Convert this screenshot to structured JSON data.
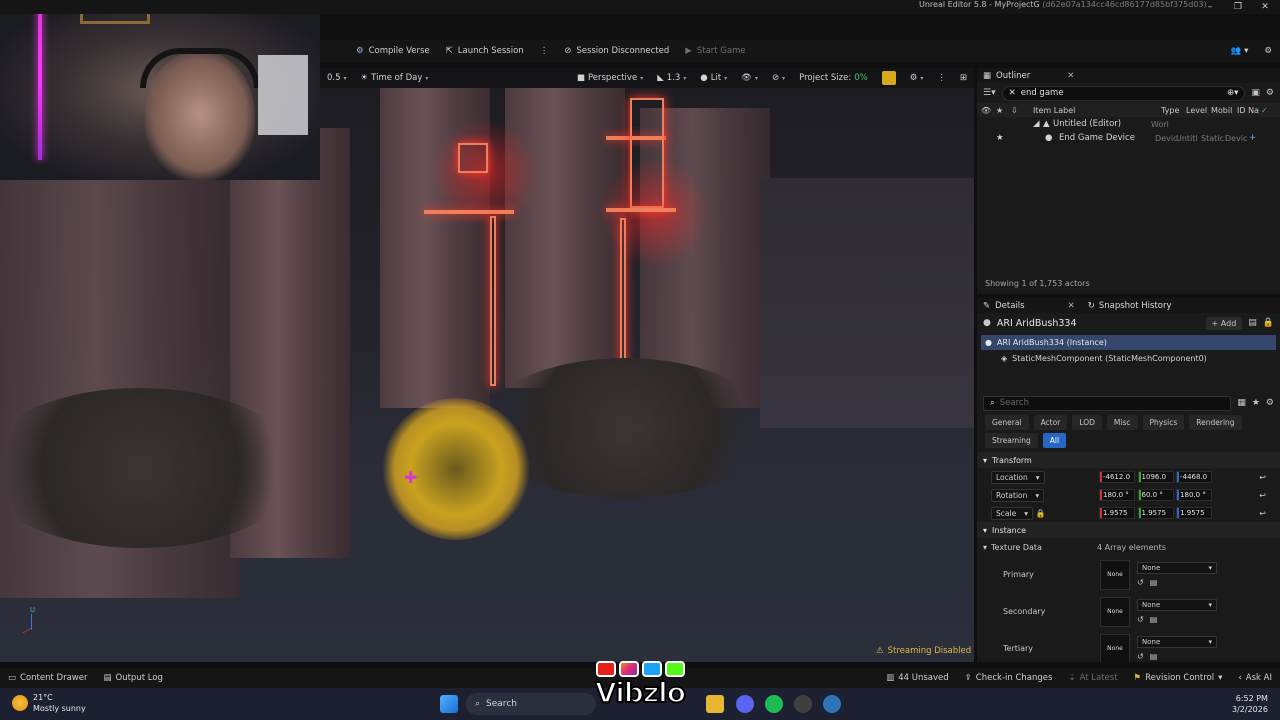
{
  "window": {
    "title": "Unreal Editor 5.8 - MyProjectG",
    "project_hash": "(d62e07a134cc46cd86177d85bf375d03)"
  },
  "toolbar": {
    "compile_verse": "Compile Verse",
    "launch_session": "Launch Session",
    "session_status": "Session Disconnected",
    "start_game": "Start Game"
  },
  "viewport": {
    "camera_speed": "0.5",
    "time_of_day": "Time of Day",
    "perspective": "Perspective",
    "fov": "1.3",
    "lit": "Lit",
    "project_size_label": "Project Size:",
    "project_size_value": "0%",
    "streaming_status": "Streaming Disabled"
  },
  "outliner": {
    "tab": "Outliner",
    "search_value": "end game",
    "columns": [
      "Item Label",
      "Type",
      "Level",
      "Mobil",
      "ID Na"
    ],
    "rows": [
      {
        "label": "Untitled (Editor)",
        "type": "Worl",
        "level": "",
        "mob": "",
        "id": ""
      },
      {
        "label": "End Game Device",
        "type": "Devic",
        "level": "Untitl",
        "mob": "Static",
        "id": "Devic"
      }
    ],
    "status": "Showing 1 of 1,753 actors"
  },
  "details": {
    "tab": "Details",
    "tab2": "Snapshot History",
    "actor_name": "ARI AridBush334",
    "add_label": "+ Add",
    "instance_row": "ARI AridBush334 (Instance)",
    "component_row": "StaticMeshComponent (StaticMeshComponent0)",
    "search_placeholder": "Search",
    "categories": [
      "General",
      "Actor",
      "LOD",
      "Misc",
      "Physics",
      "Rendering",
      "Streaming",
      "All"
    ],
    "transform_header": "Transform",
    "location": {
      "label": "Location",
      "x": "-4612.0",
      "y": "1096.0",
      "z": "-4468.0"
    },
    "rotation": {
      "label": "Rotation",
      "x": "180.0 °",
      "y": "60.0 °",
      "z": "180.0 °"
    },
    "scale": {
      "label": "Scale",
      "x": "1.9575",
      "y": "1.9575",
      "z": "1.9575"
    },
    "instance_header": "Instance",
    "texture_data": "Texture Data",
    "array_elements": "4 Array elements",
    "textures": [
      {
        "label": "Primary",
        "thumb": "None",
        "value": "None"
      },
      {
        "label": "Secondary",
        "thumb": "None",
        "value": "None"
      },
      {
        "label": "Tertiary",
        "thumb": "None",
        "value": "None"
      }
    ]
  },
  "bottombar": {
    "content_drawer": "Content Drawer",
    "output_log": "Output Log",
    "unsaved": "44 Unsaved",
    "check_in": "Check-in Changes",
    "at_latest": "At Latest",
    "revision_control": "Revision Control",
    "ask_ai": "Ask AI"
  },
  "taskbar": {
    "weather_temp": "21°C",
    "weather_desc": "Mostly sunny",
    "search": "Search",
    "time": "6:52 PM",
    "date": "3/2/2026"
  },
  "overlay": {
    "brand": "Vibzlo"
  }
}
